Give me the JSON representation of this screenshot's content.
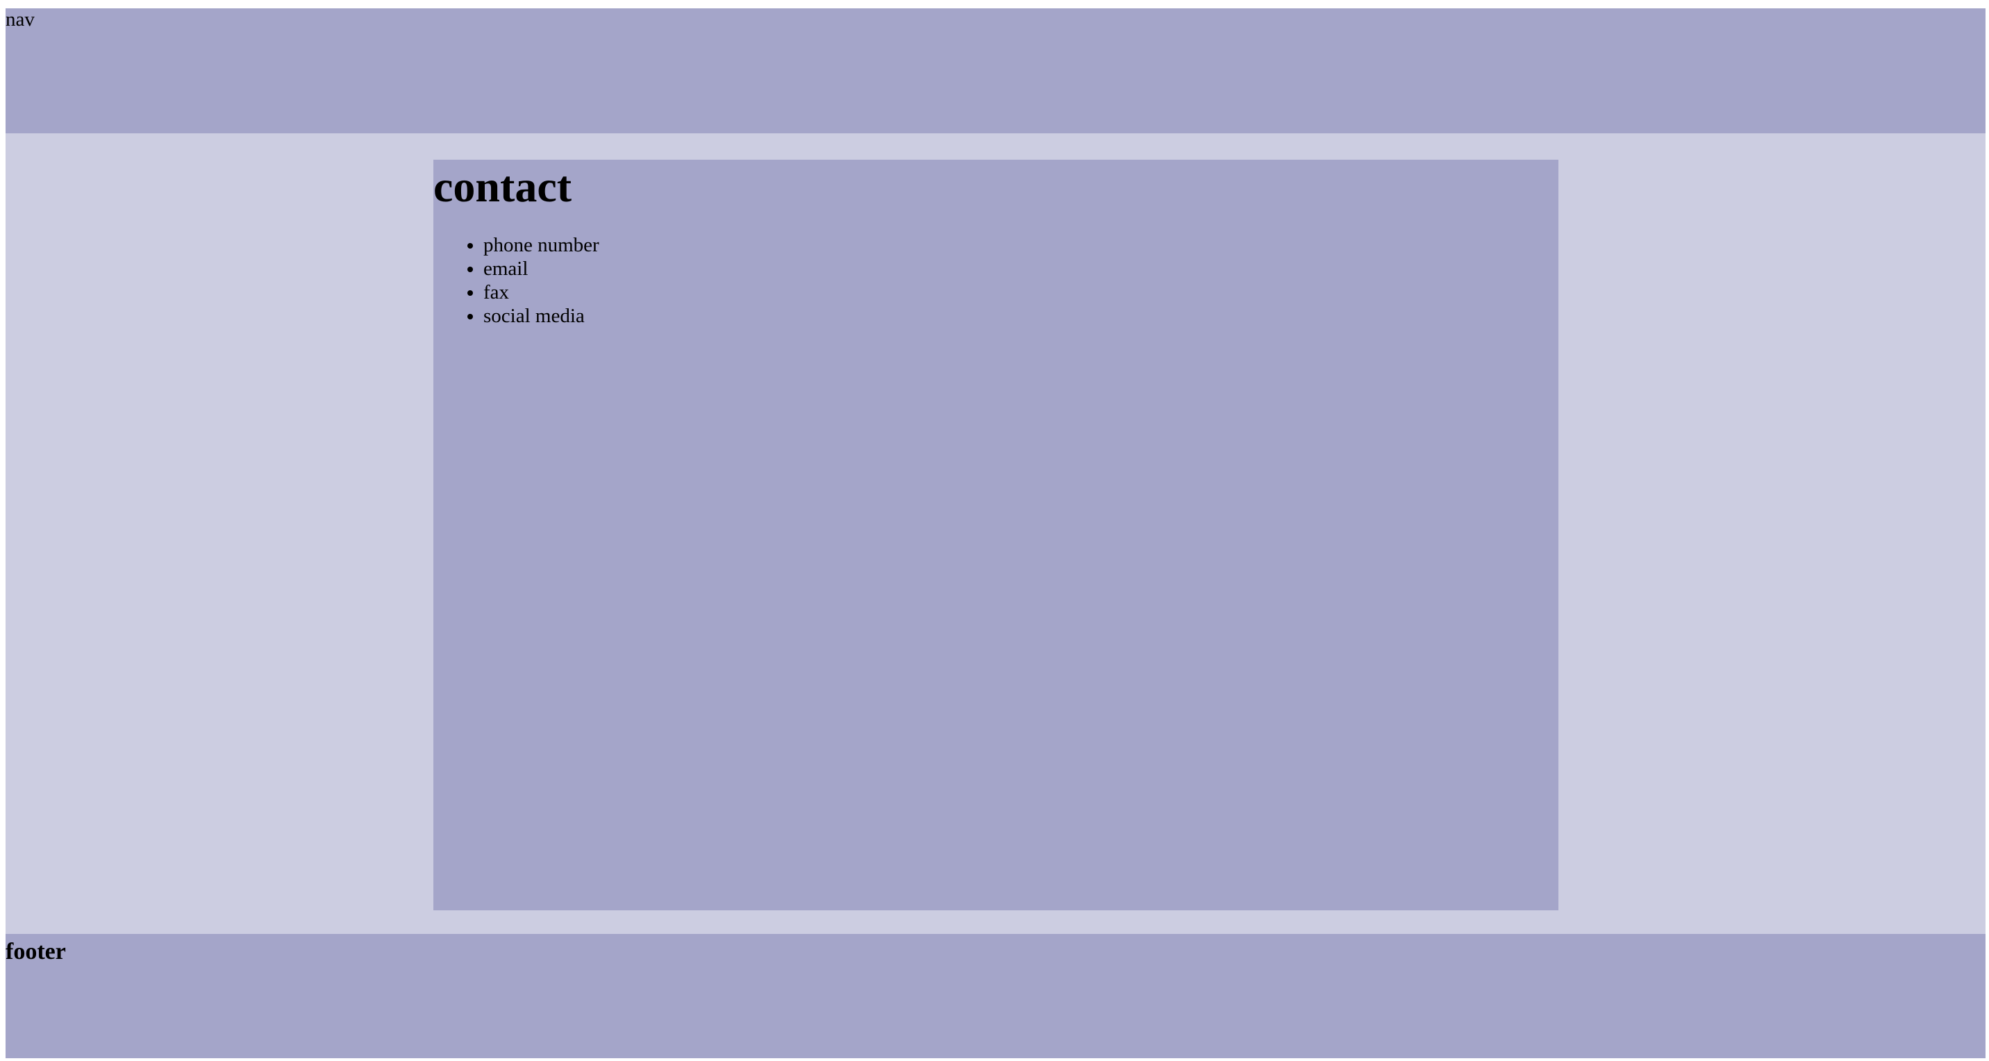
{
  "nav": {
    "label": "nav"
  },
  "content": {
    "title": "contact",
    "items": [
      "phone number",
      "email",
      "fax",
      "social media"
    ]
  },
  "footer": {
    "label": "footer"
  },
  "colors": {
    "page_background": "#cccde1",
    "panel_background": "#a4a5c9",
    "text": "#000000"
  }
}
